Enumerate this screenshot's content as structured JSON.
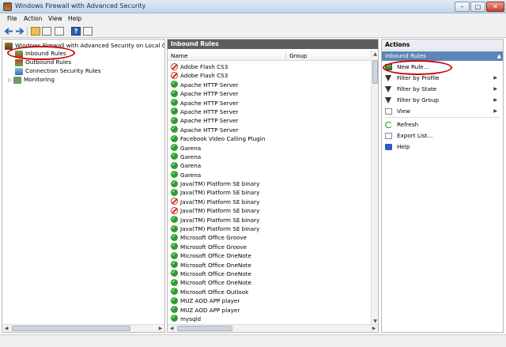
{
  "window": {
    "title": "Windows Firewall with Advanced Security",
    "minimize_label": "–",
    "maximize_label": "□",
    "close_label": "✕"
  },
  "menu": {
    "file": "File",
    "action": "Action",
    "view": "View",
    "help": "Help"
  },
  "tree": {
    "root": "Windows Firewall with Advanced Security on Local Comput",
    "inbound": "Inbound Rules",
    "outbound": "Outbound Rules",
    "connection_security": "Connection Security Rules",
    "monitoring": "Monitoring"
  },
  "middle": {
    "header": "Inbound Rules",
    "col_name": "Name",
    "col_group": "Group",
    "rules": [
      {
        "name": "Adobe Flash CS3",
        "status": "block"
      },
      {
        "name": "Adobe Flash CS3",
        "status": "block"
      },
      {
        "name": "Apache HTTP Server",
        "status": "allow"
      },
      {
        "name": "Apache HTTP Server",
        "status": "allow"
      },
      {
        "name": "Apache HTTP Server",
        "status": "allow"
      },
      {
        "name": "Apache HTTP Server",
        "status": "allow"
      },
      {
        "name": "Apache HTTP Server",
        "status": "allow"
      },
      {
        "name": "Apache HTTP Server",
        "status": "allow"
      },
      {
        "name": "Facebook Video Calling Plugin",
        "status": "allow"
      },
      {
        "name": "Garena",
        "status": "allow"
      },
      {
        "name": "Garena",
        "status": "allow"
      },
      {
        "name": "Garena",
        "status": "allow"
      },
      {
        "name": "Garena",
        "status": "allow"
      },
      {
        "name": "Java(TM) Platform SE binary",
        "status": "allow"
      },
      {
        "name": "Java(TM) Platform SE binary",
        "status": "allow"
      },
      {
        "name": "Java(TM) Platform SE binary",
        "status": "block"
      },
      {
        "name": "Java(TM) Platform SE binary",
        "status": "block"
      },
      {
        "name": "Java(TM) Platform SE binary",
        "status": "allow"
      },
      {
        "name": "Java(TM) Platform SE binary",
        "status": "allow"
      },
      {
        "name": "Microsoft Office Groove",
        "status": "allow"
      },
      {
        "name": "Microsoft Office Groove",
        "status": "allow"
      },
      {
        "name": "Microsoft Office OneNote",
        "status": "allow"
      },
      {
        "name": "Microsoft Office OneNote",
        "status": "allow"
      },
      {
        "name": "Microsoft Office OneNote",
        "status": "allow"
      },
      {
        "name": "Microsoft Office OneNote",
        "status": "allow"
      },
      {
        "name": "Microsoft Office Outlook",
        "status": "allow"
      },
      {
        "name": "MUZ AOD APP player",
        "status": "allow"
      },
      {
        "name": "MUZ AOD APP player",
        "status": "allow"
      },
      {
        "name": "mysqld",
        "status": "allow"
      }
    ]
  },
  "actions": {
    "header": "Actions",
    "section": "Inbound Rules",
    "section_caret": "▲",
    "items": [
      {
        "label": "New Rule...",
        "icon": "new-rule-icon"
      },
      {
        "label": "Filter by Profile",
        "icon": "filter-icon",
        "submenu": true
      },
      {
        "label": "Filter by State",
        "icon": "filter-icon",
        "submenu": true
      },
      {
        "label": "Filter by Group",
        "icon": "filter-icon",
        "submenu": true
      },
      {
        "label": "View",
        "icon": "view-icon",
        "submenu": true
      },
      {
        "label": "Refresh",
        "icon": "refresh-icon"
      },
      {
        "label": "Export List...",
        "icon": "export-icon"
      },
      {
        "label": "Help",
        "icon": "help-icon"
      }
    ]
  },
  "colors": {
    "annotation_red": "#cc0a0a",
    "allow_green": "#2f9c2f",
    "block_red": "#c6302a",
    "section_blue": "#5c86b8"
  }
}
